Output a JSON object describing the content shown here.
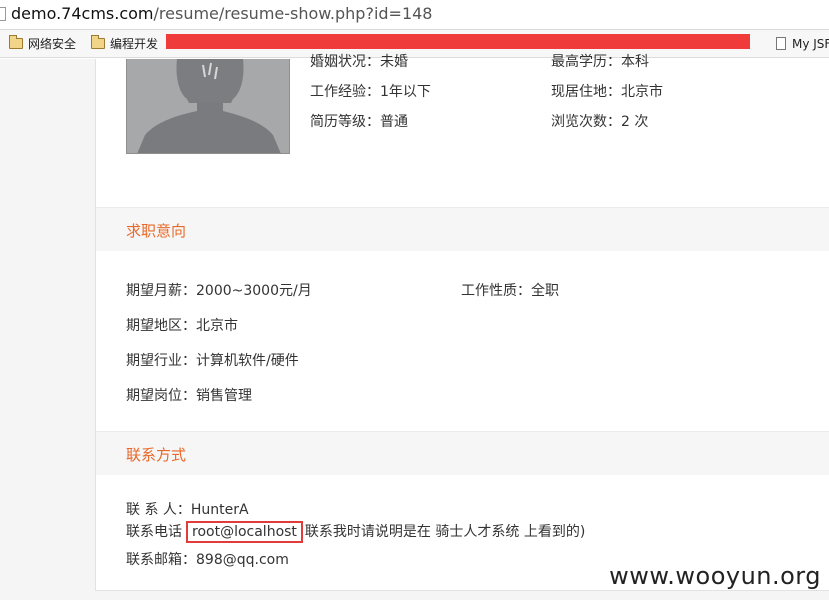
{
  "browser": {
    "url_host": "demo.74cms.com",
    "url_path": "/resume/resume-show.php?id=148",
    "bookmarks": [
      {
        "label": "网络安全"
      },
      {
        "label": "编程开发"
      },
      {
        "label": "My JSF"
      }
    ]
  },
  "profile": {
    "marital_label": "婚姻状况：未婚",
    "education_label": "最高学历：本科",
    "experience_label": "工作经验：1年以下",
    "residence_label": "现居住地：北京市",
    "level_label": "简历等级：普通",
    "views_label": "浏览次数：2 次"
  },
  "intent": {
    "title": "求职意向",
    "salary": "期望月薪：2000~3000元/月",
    "job_type": "工作性质：全职",
    "region": "期望地区：北京市",
    "industry": "期望行业：计算机软件/硬件",
    "position": "期望岗位：销售管理"
  },
  "contact": {
    "title": "联系方式",
    "person": "联 系 人：HunterA",
    "phone_label": "联系电话",
    "phone_value": "root@localhost",
    "phone_note": "联系我时请说明是在 骑士人才系统 上看到的)",
    "email": "联系邮箱：898@qq.com"
  },
  "watermark": "www.wooyun.org"
}
